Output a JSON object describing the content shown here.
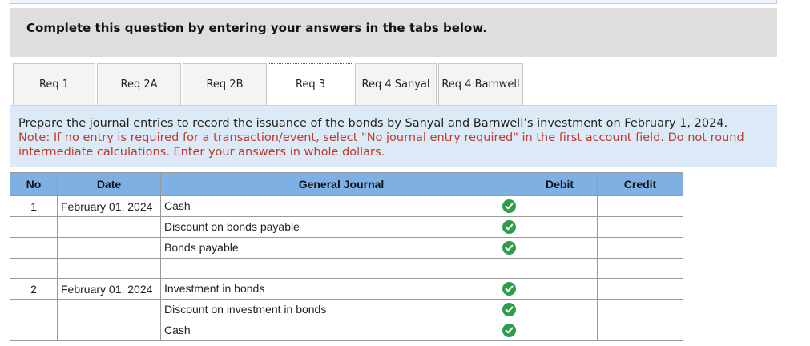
{
  "header": {
    "text": "Complete this question by entering your answers in the tabs below."
  },
  "tabs": [
    {
      "label": "Req 1",
      "active": false
    },
    {
      "label": "Req 2A",
      "active": false
    },
    {
      "label": "Req 2B",
      "active": false
    },
    {
      "label": "Req 3",
      "active": true
    },
    {
      "label": "Req 4 Sanyal",
      "active": false
    },
    {
      "label": "Req 4 Barnwell",
      "active": false
    }
  ],
  "instructions": {
    "main": "Prepare the journal entries to record the issuance of the bonds by Sanyal and Barnwell’s investment on February 1, 2024.",
    "note": "Note: If no entry is required for a transaction/event, select \"No journal entry required\" in the first account field. Do not round intermediate calculations. Enter your answers in whole dollars."
  },
  "table": {
    "headers": {
      "no": "No",
      "date": "Date",
      "journal": "General Journal",
      "debit": "Debit",
      "credit": "Credit"
    },
    "rows": [
      {
        "no": "1",
        "date": "February 01, 2024",
        "account": "Cash",
        "debit": "",
        "credit": "",
        "check": true
      },
      {
        "no": "",
        "date": "",
        "account": "Discount on bonds payable",
        "debit": "",
        "credit": "",
        "check": true
      },
      {
        "no": "",
        "date": "",
        "account": "Bonds payable",
        "debit": "",
        "credit": "",
        "check": true
      },
      {
        "no": "",
        "date": "",
        "account": "",
        "debit": "",
        "credit": "",
        "check": false
      },
      {
        "no": "2",
        "date": "February 01, 2024",
        "account": "Investment in bonds",
        "debit": "",
        "credit": "",
        "check": true
      },
      {
        "no": "",
        "date": "",
        "account": "Discount on investment in bonds",
        "debit": "",
        "credit": "",
        "check": true
      },
      {
        "no": "",
        "date": "",
        "account": "Cash",
        "debit": "",
        "credit": "",
        "check": true
      }
    ]
  },
  "colors": {
    "header_bg": "#dedede",
    "table_header_bg": "#7fb0e4",
    "instr_bg": "#dceaf7",
    "note_red": "#c0392b",
    "check_green": "#2e9d4a"
  }
}
